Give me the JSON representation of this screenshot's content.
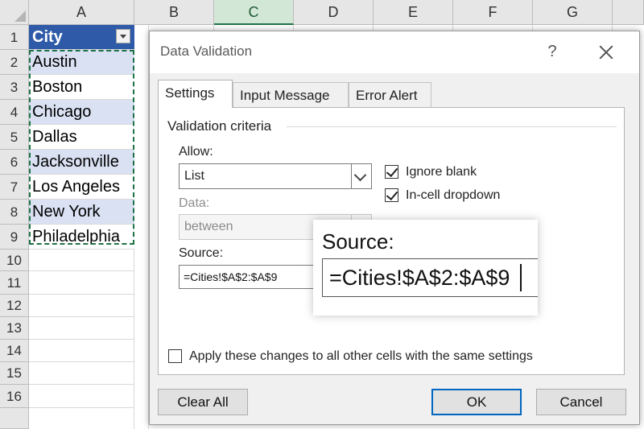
{
  "sheet": {
    "columns": [
      "A",
      "B",
      "C",
      "D",
      "E",
      "F",
      "G"
    ],
    "active_column": "C",
    "rows": [
      "1",
      "2",
      "3",
      "4",
      "5",
      "6",
      "7",
      "8",
      "9",
      "10",
      "11",
      "12",
      "13",
      "14",
      "15",
      "16"
    ],
    "header_cell": "City",
    "cities": [
      "Austin",
      "Boston",
      "Chicago",
      "Dallas",
      "Jacksonville",
      "Los Angeles",
      "New York",
      "Philadelphia"
    ],
    "colors": {
      "header_fill": "#2e5aa8",
      "band_fill": "#d9e1f2",
      "selection_border": "#1e7145"
    }
  },
  "dialog": {
    "title": "Data Validation",
    "help_icon": "?",
    "tabs": [
      "Settings",
      "Input Message",
      "Error Alert"
    ],
    "active_tab": "Settings",
    "group_label": "Validation criteria",
    "allow_label": "Allow:",
    "allow_value": "List",
    "data_label": "Data:",
    "data_value": "between",
    "source_label": "Source:",
    "source_value": "=Cities!$A$2:$A$9",
    "ignore_blank_label": "Ignore blank",
    "ignore_blank_checked": true,
    "in_cell_dropdown_label": "In-cell dropdown",
    "in_cell_dropdown_checked": true,
    "apply_all_label": "Apply these changes to all other cells with the same settings",
    "apply_all_checked": false,
    "clear_all_label": "Clear All",
    "ok_label": "OK",
    "cancel_label": "Cancel"
  },
  "callout": {
    "label": "Source:",
    "value": "=Cities!$A$2:$A$9"
  }
}
